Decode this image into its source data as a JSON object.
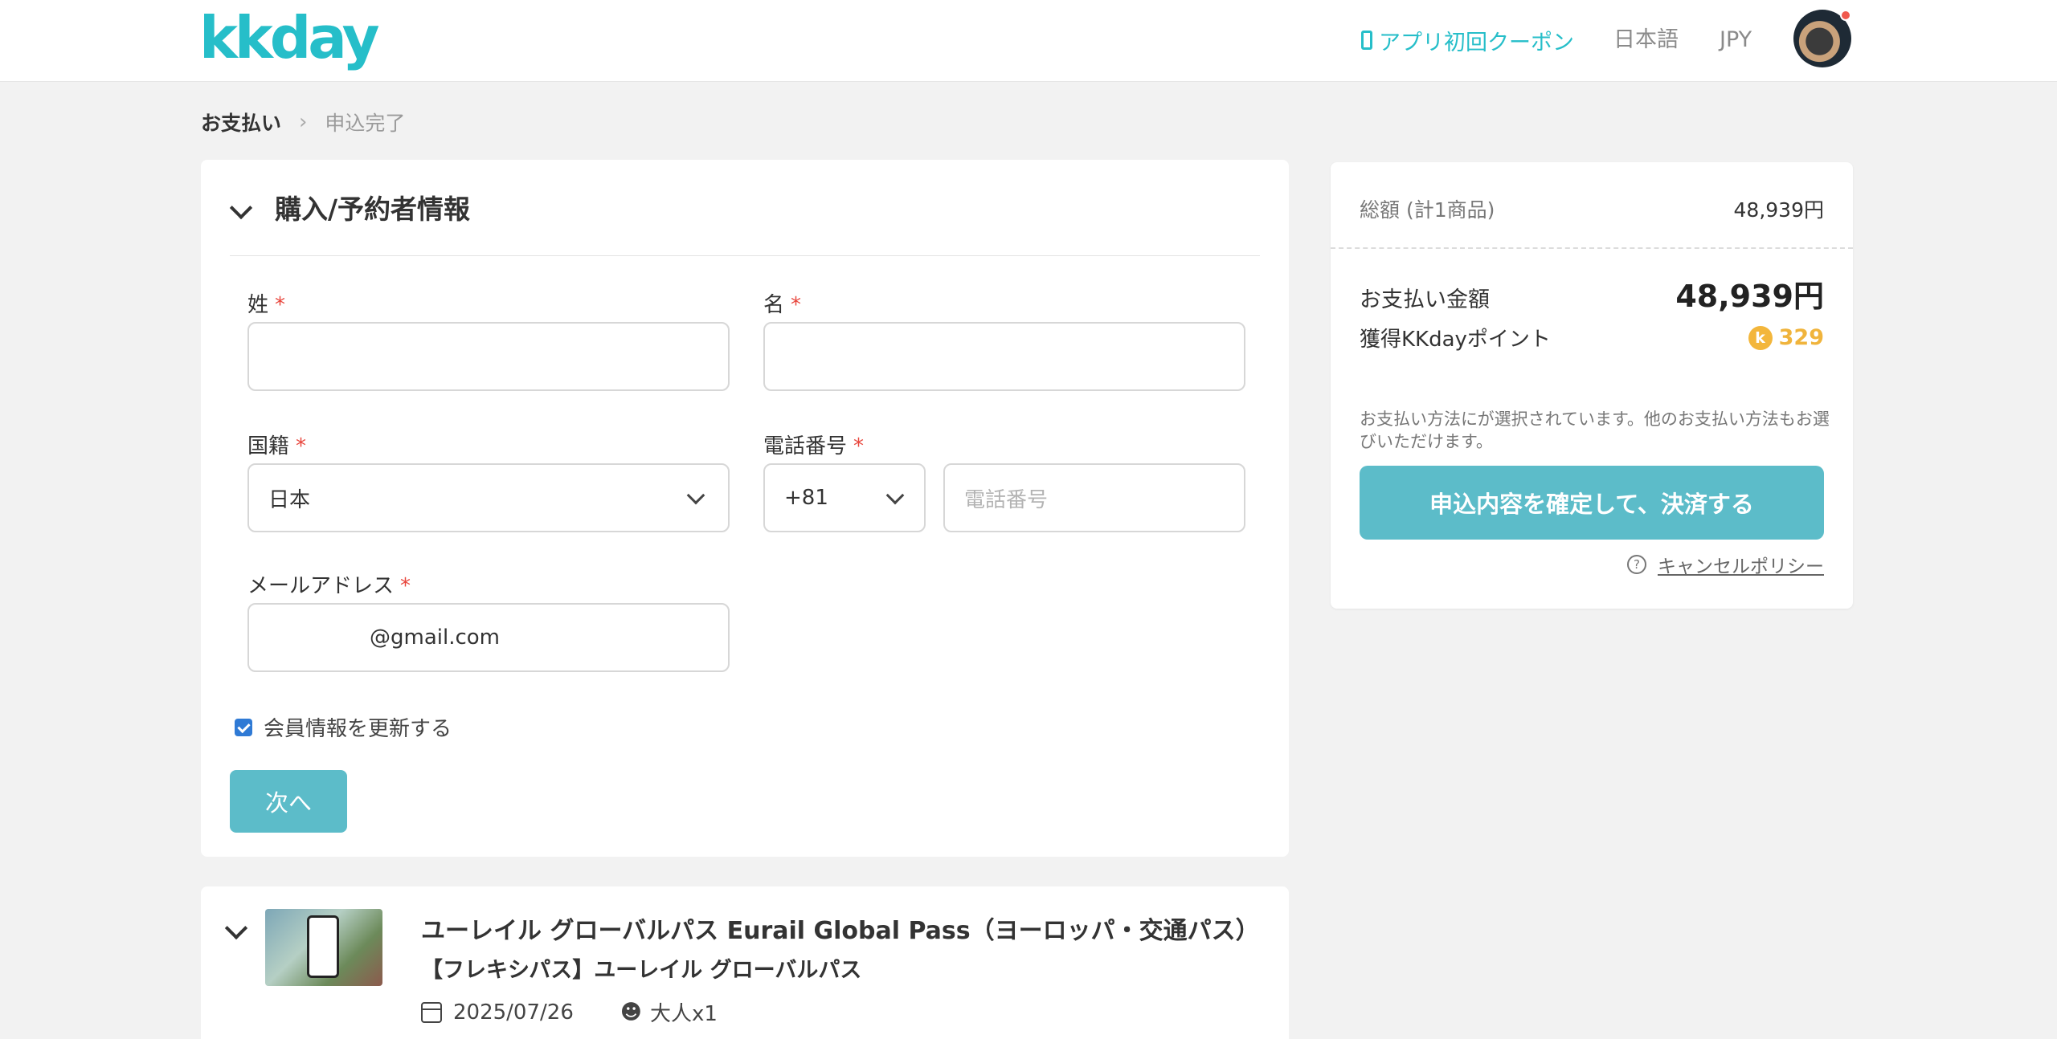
{
  "header": {
    "logo_text": "kkday",
    "coupon_label": "アプリ初回クーポン",
    "language": "日本語",
    "currency": "JPY"
  },
  "breadcrumb": {
    "current": "お支払い",
    "separator": "›",
    "next": "申込完了"
  },
  "buyer_form": {
    "section_title": "購入/予約者情報",
    "last_name_label": "姓",
    "first_name_label": "名",
    "required_mark": "*",
    "last_name_value": "",
    "first_name_value": "",
    "nationality_label": "国籍",
    "nationality_value": "日本",
    "phone_label": "電話番号",
    "phone_code": "+81",
    "phone_placeholder": "電話番号",
    "email_label": "メールアドレス",
    "email_value": "@gmail.com",
    "update_member_label": "会員情報を更新する",
    "update_member_checked": true,
    "next_button": "次へ"
  },
  "product": {
    "title": "ユーレイル グローバルパス Eurail Global Pass（ヨーロッパ・交通パス）",
    "subtitle": "【フレキシパス】ユーレイル グローバルパス",
    "date": "2025/07/26",
    "people": "大人x1"
  },
  "summary": {
    "total_label": "総額 (計1商品)",
    "total_value": "48,939円",
    "pay_label": "お支払い金額",
    "pay_value": "48,939円",
    "points_label": "獲得KKdayポイント",
    "points_coin": "k",
    "points_value": "329",
    "note": "お支払い方法にが選択されています。他のお支払い方法もお選びいただけます。",
    "confirm_button": "申込内容を確定して、決済する",
    "cancel_policy": "キャンセルポリシー"
  },
  "colors": {
    "brand": "#26bec9",
    "button": "#5cbcc9",
    "required": "#e8473e",
    "points": "#f0b43c",
    "checkbox": "#2f7ad5"
  }
}
